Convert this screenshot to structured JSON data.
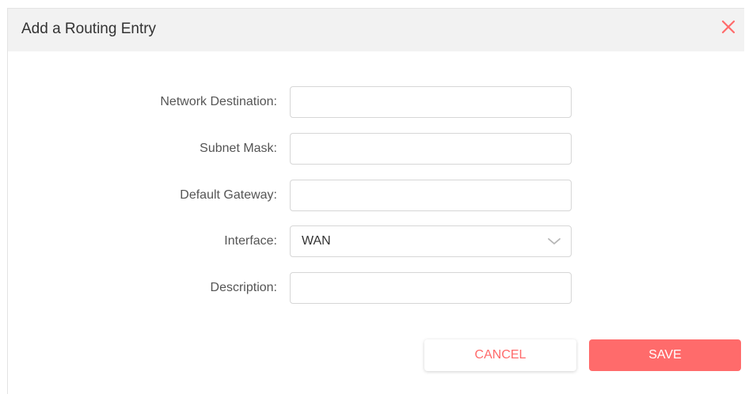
{
  "dialog": {
    "title": "Add a Routing Entry",
    "close_icon": "close-icon"
  },
  "form": {
    "network_destination": {
      "label": "Network Destination:",
      "value": ""
    },
    "subnet_mask": {
      "label": "Subnet Mask:",
      "value": ""
    },
    "default_gateway": {
      "label": "Default Gateway:",
      "value": ""
    },
    "interface": {
      "label": "Interface:",
      "selected": "WAN",
      "icon": "chevron-down-icon"
    },
    "description": {
      "label": "Description:",
      "value": ""
    }
  },
  "actions": {
    "cancel_label": "CANCEL",
    "save_label": "SAVE"
  },
  "colors": {
    "accent": "#ff6b6b",
    "header_bg": "#f2f2f2",
    "border": "#d6d6d6"
  }
}
